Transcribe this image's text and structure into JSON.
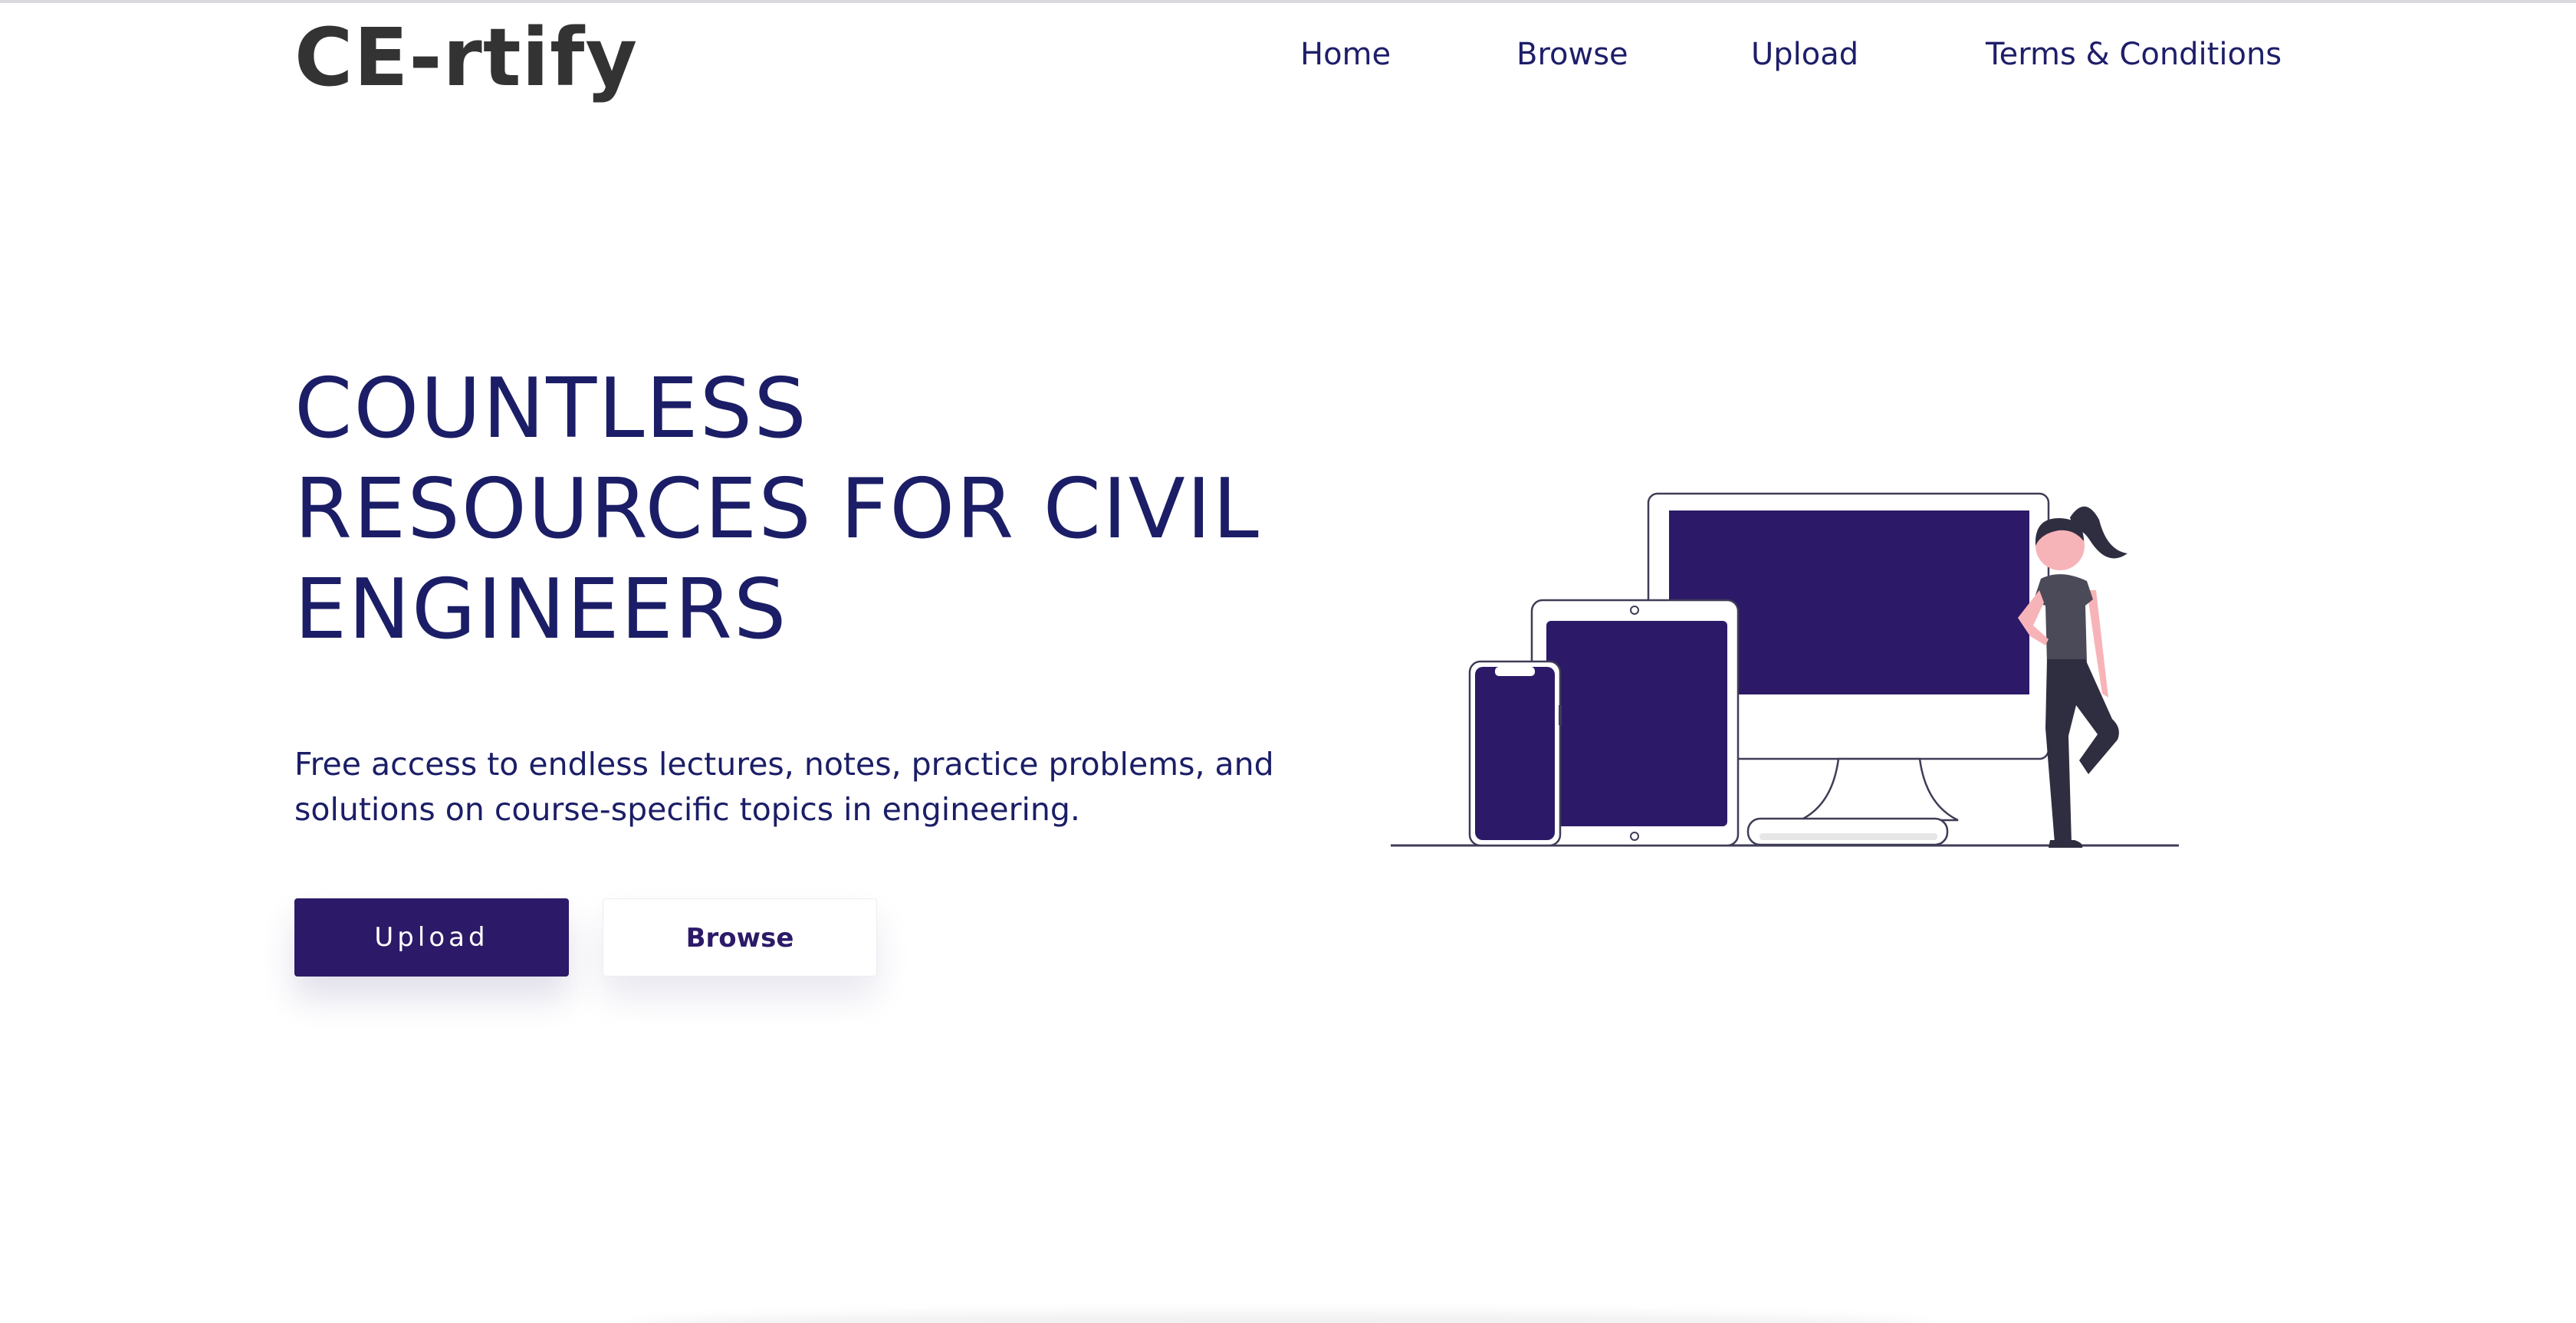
{
  "header": {
    "brand": "CE-rtify",
    "nav": [
      {
        "label": "Home"
      },
      {
        "label": "Browse"
      },
      {
        "label": "Upload"
      },
      {
        "label": "Terms & Conditions"
      }
    ]
  },
  "hero": {
    "title_lines": [
      "COUNTLESS",
      "RESOURCES FOR CIVIL",
      "ENGINEERS"
    ],
    "subtitle_lines": [
      "Free access to endless lectures, notes, practice problems, and",
      "solutions on course-specific topics in engineering."
    ],
    "upload_button": "Upload",
    "browse_button": "Browse"
  },
  "colors": {
    "brand_text": "#333333",
    "accent": "#2c1a68",
    "heading": "#1b1e66",
    "skin": "#f7b4b8",
    "hair": "#2f2e41"
  },
  "illustration": {
    "icon": "devices-with-person-illustration"
  }
}
